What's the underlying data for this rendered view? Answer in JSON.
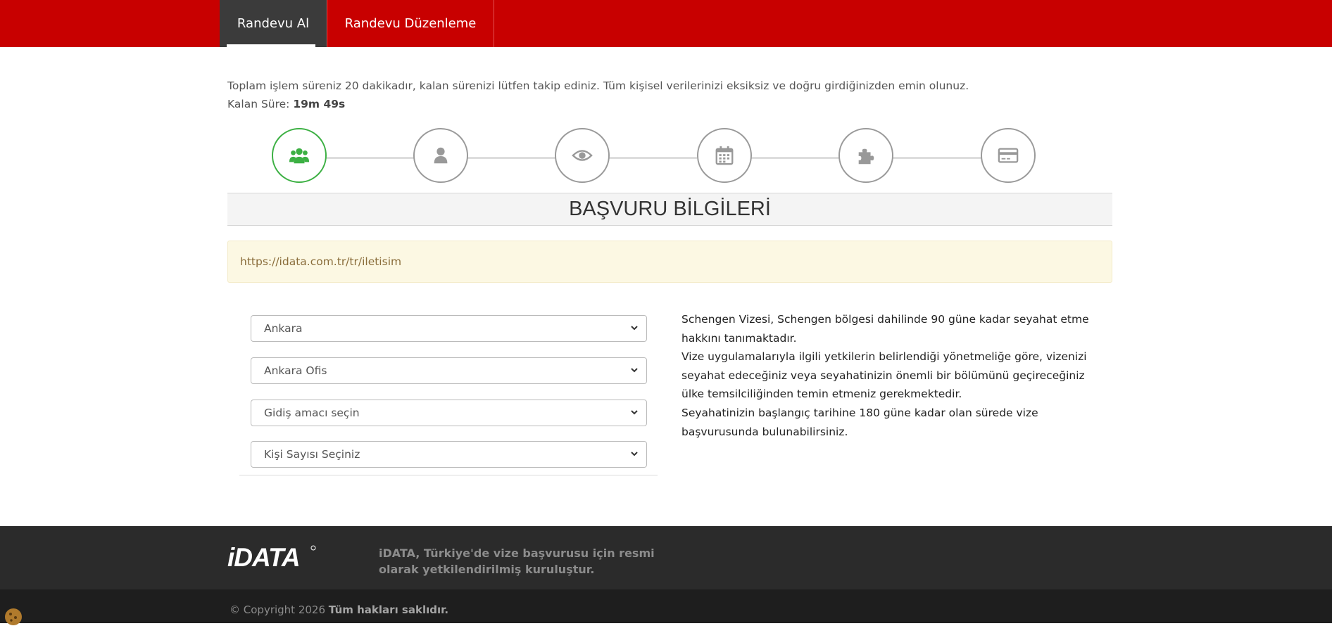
{
  "nav": {
    "tabs": [
      {
        "label": "Randevu Al",
        "active": true
      },
      {
        "label": "Randevu Düzenleme",
        "active": false
      }
    ]
  },
  "info": {
    "notice": "Toplam işlem süreniz 20 dakikadır, kalan sürenizi lütfen takip ediniz. Tüm kişisel verilerinizi eksiksiz ve doğru girdiğinizden emin olunuz.",
    "timer_label": "Kalan Süre:",
    "timer_value": "19m 49s"
  },
  "steps": [
    {
      "icon": "users-icon",
      "active": true
    },
    {
      "icon": "user-icon",
      "active": false
    },
    {
      "icon": "eye-icon",
      "active": false
    },
    {
      "icon": "calendar-icon",
      "active": false
    },
    {
      "icon": "puzzle-icon",
      "active": false
    },
    {
      "icon": "credit-card-icon",
      "active": false
    }
  ],
  "section_title": "BAŞVURU BİLGİLERİ",
  "alert_text": "https://idata.com.tr/tr/iletisim",
  "form": {
    "city": "Ankara",
    "office": "Ankara Ofis",
    "purpose": "Gidiş amacı seçin",
    "people": "Kişi Sayısı Seçiniz"
  },
  "description": {
    "p1": "Schengen Vizesi, Schengen bölgesi dahilinde 90 güne kadar seyahat etme hakkını tanımaktadır.",
    "p2": "Vize uygulamalarıyla ilgili yetkilerin belirlendiği yönetmeliğe göre, vizenizi seyahat edeceğiniz veya seyahatinizin önemli bir bölümünü geçireceğiniz ülke temsilciliğinden temin etmeniz gerekmektedir.",
    "p3": "Seyahatinizin başlangıç tarihine 180 güne kadar olan sürede vize başvurusunda bulunabilirsiniz."
  },
  "footer": {
    "logo_text": "iDATA",
    "tagline": "iDATA, Türkiye'de vize başvurusu için resmi olarak yetkilendirilmiş kuruluştur.",
    "copyright": "© Copyright 2026",
    "rights": "Tüm hakları saklıdır."
  },
  "colors": {
    "brand_red": "#c80000",
    "active_step": "#3cb043",
    "inactive_step": "#9a9a9a",
    "footer_bg": "#2b2b2b"
  }
}
